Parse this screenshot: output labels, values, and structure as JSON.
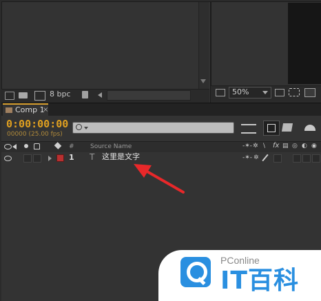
{
  "project_panel": {
    "bit_depth": "8 bpc"
  },
  "viewer": {
    "magnification": "50%"
  },
  "timeline": {
    "tab_label": "Comp 1",
    "timecode": "0:00:00:00",
    "frame_readout": "00000 (25.00 fps)",
    "columns": {
      "number": "#",
      "source_name": "Source Name"
    },
    "layers": [
      {
        "number": "1",
        "type_glyph": "T",
        "name": "这里是文字"
      }
    ]
  },
  "icons": {
    "close": "×",
    "shy": "-✶-",
    "collapse": "✲",
    "quality": "\\",
    "effects": "fx",
    "frame_blend": "▤",
    "motion_blur": "◎",
    "adjustment": "◐",
    "three_d": "◉"
  },
  "watermark": {
    "brand": "PConline",
    "site_name": "IT百科"
  },
  "colors": {
    "timecode": "#e0a020",
    "layer_label": "#b83030",
    "annotation_arrow": "#e8282a",
    "brand_blue": "#2a8fe0"
  }
}
